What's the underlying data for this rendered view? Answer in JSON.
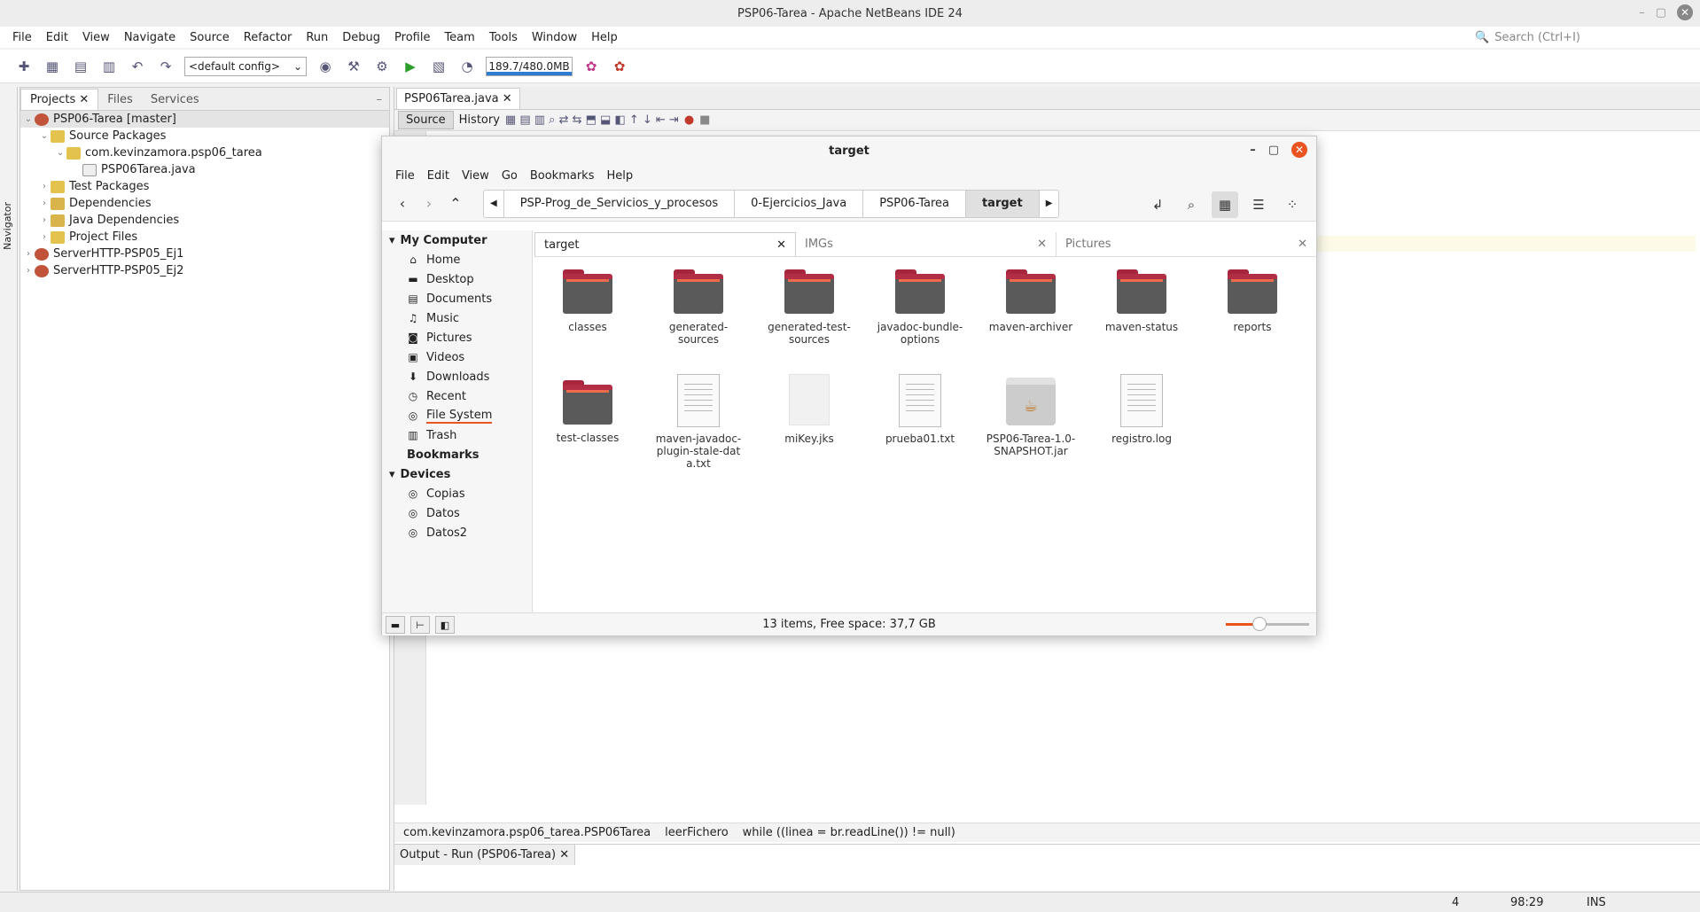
{
  "window": {
    "title": "PSP06-Tarea - Apache NetBeans IDE 24"
  },
  "menu": [
    "File",
    "Edit",
    "View",
    "Navigate",
    "Source",
    "Refactor",
    "Run",
    "Debug",
    "Profile",
    "Team",
    "Tools",
    "Window",
    "Help"
  ],
  "search": {
    "placeholder": "Search (Ctrl+I)"
  },
  "toolbar": {
    "config": "<default config>",
    "memory": "189.7/480.0MB"
  },
  "navigator": {
    "label": "Navigator"
  },
  "projects": {
    "tabs": [
      "Projects",
      "Files",
      "Services"
    ],
    "tree": [
      {
        "label": "PSP06-Tarea [master]",
        "level": 0,
        "icon": "project",
        "expanded": true
      },
      {
        "label": "Source Packages",
        "level": 1,
        "icon": "package-folder",
        "expanded": true
      },
      {
        "label": "com.kevinzamora.psp06_tarea",
        "level": 2,
        "icon": "package",
        "expanded": true
      },
      {
        "label": "PSP06Tarea.java",
        "level": 3,
        "icon": "java-file"
      },
      {
        "label": "Test Packages",
        "level": 1,
        "icon": "package-folder",
        "expanded": false
      },
      {
        "label": "Dependencies",
        "level": 1,
        "icon": "dependencies",
        "expanded": false
      },
      {
        "label": "Java Dependencies",
        "level": 1,
        "icon": "dependencies",
        "expanded": false
      },
      {
        "label": "Project Files",
        "level": 1,
        "icon": "folder",
        "expanded": false
      },
      {
        "label": "ServerHTTP-PSP05_Ej1",
        "level": 0,
        "icon": "project",
        "expanded": false
      },
      {
        "label": "ServerHTTP-PSP05_Ej2",
        "level": 0,
        "icon": "project",
        "expanded": false
      }
    ]
  },
  "editor": {
    "tab": "PSP06Tarea.java",
    "source_label": "Source",
    "history_label": "History",
    "breadcrumbs": [
      "com.kevinzamora.psp06_tarea.PSP06Tarea",
      "leerFichero",
      "while ((linea = br.readLine()) != null)"
    ]
  },
  "output": {
    "tab": "Output - Run (PSP06-Tarea)"
  },
  "status": {
    "notifications": "4",
    "position": "98:29",
    "mode": "INS"
  },
  "filemanager": {
    "title": "target",
    "menu": [
      "File",
      "Edit",
      "View",
      "Go",
      "Bookmarks",
      "Help"
    ],
    "breadcrumbs": [
      "PSP-Prog_de_Servicios_y_procesos",
      "0-Ejercicios_Java",
      "PSP06-Tarea",
      "target"
    ],
    "sidebar": {
      "my_computer": "My Computer",
      "places": [
        {
          "label": "Home",
          "icon": "home-icon",
          "glyph": "⌂"
        },
        {
          "label": "Desktop",
          "icon": "desktop-icon",
          "glyph": "▬"
        },
        {
          "label": "Documents",
          "icon": "documents-icon",
          "glyph": "▤"
        },
        {
          "label": "Music",
          "icon": "music-icon",
          "glyph": "♫"
        },
        {
          "label": "Pictures",
          "icon": "pictures-icon",
          "glyph": "◙"
        },
        {
          "label": "Videos",
          "icon": "videos-icon",
          "glyph": "▣"
        },
        {
          "label": "Downloads",
          "icon": "downloads-icon",
          "glyph": "⬇"
        },
        {
          "label": "Recent",
          "icon": "recent-icon",
          "glyph": "◷"
        },
        {
          "label": "File System",
          "icon": "filesystem-icon",
          "glyph": "◎"
        },
        {
          "label": "Trash",
          "icon": "trash-icon",
          "glyph": "▥"
        }
      ],
      "bookmarks": "Bookmarks",
      "devices_label": "Devices",
      "devices": [
        "Copias",
        "Datos",
        "Datos2"
      ]
    },
    "tabs": [
      "target",
      "IMGs",
      "Pictures"
    ],
    "items": [
      {
        "name": "classes",
        "type": "folder"
      },
      {
        "name": "generated-sources",
        "type": "folder"
      },
      {
        "name": "generated-test-sources",
        "type": "folder"
      },
      {
        "name": "javadoc-bundle-options",
        "type": "folder"
      },
      {
        "name": "maven-archiver",
        "type": "folder"
      },
      {
        "name": "maven-status",
        "type": "folder"
      },
      {
        "name": "reports",
        "type": "folder"
      },
      {
        "name": "test-classes",
        "type": "folder"
      },
      {
        "name": "maven-javadoc-plugin-stale-data.txt",
        "type": "text"
      },
      {
        "name": "miKey.jks",
        "type": "blank"
      },
      {
        "name": "prueba01.txt",
        "type": "text"
      },
      {
        "name": "PSP06-Tarea-1.0-SNAPSHOT.jar",
        "type": "jar"
      },
      {
        "name": "registro.log",
        "type": "text"
      }
    ],
    "status": "13 items, Free space: 37,7 GB",
    "zoom_level": 0.4
  }
}
